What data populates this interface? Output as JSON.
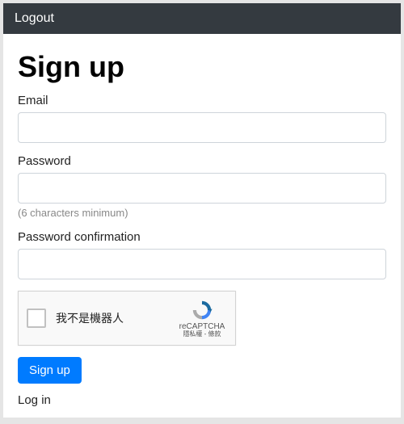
{
  "navbar": {
    "logout": "Logout"
  },
  "page": {
    "title": "Sign up"
  },
  "form": {
    "email_label": "Email",
    "email_value": "",
    "password_label": "Password",
    "password_value": "",
    "password_hint": "(6 characters minimum)",
    "password_confirm_label": "Password confirmation",
    "password_confirm_value": "",
    "submit_label": "Sign up"
  },
  "recaptcha": {
    "label": "我不是機器人",
    "brand": "reCAPTCHA",
    "links": "隱私權 - 條款"
  },
  "links": {
    "login": "Log in"
  },
  "colors": {
    "navbar_bg": "#343a40",
    "primary": "#007bff",
    "border": "#ced4da",
    "hint": "#888888"
  }
}
